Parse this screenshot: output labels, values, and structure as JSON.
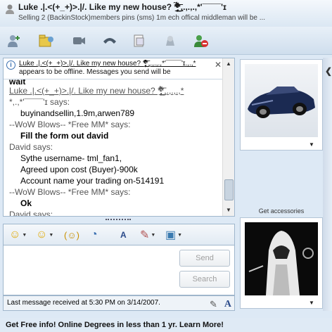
{
  "window": {
    "title": "Luke .|.<(+_+)>.|/. Like my new house? *̡̢̛̹̹̬̙̱̩̝̞͌ͦ̃̆̽͊̈́ͥ̾͗ͨͨ͟͢͜͢͞͞*,.,.,.,*'¯¯¯¯'ɪ",
    "status": "Selling 2 (BackinStock)members pins (sms) 1m ech offical middleman will be ..."
  },
  "toolbar": {
    "buttons": [
      {
        "name": "invite-icon"
      },
      {
        "name": "send-files-icon"
      },
      {
        "name": "video-icon"
      },
      {
        "name": "call-icon"
      },
      {
        "name": "activities-icon"
      },
      {
        "name": "games-icon"
      },
      {
        "name": "block-icon"
      }
    ]
  },
  "notice": {
    "line1": "Luke .|.<(+_+)>.|/. Like my new house? *̡̢̛̹̹̬̙̱̩̝̞͌ͦ̃̆̽͊̈́ͥ̾͗ͨͨ͟͢͜͢͞͞*,.,.,.,*'¯¯¯¯'ɪ.,.,*",
    "line2": "appears to be offline. Messages you send will be"
  },
  "messages": {
    "partial_top": "wait",
    "luke_sender_1": "Luke .|.<(+_+)>.|/. Like my new house? *̡̢̛̹̹̬̙̱̩̝̞͌ͦ̃̆̽͊̈́ͥ̾͗ͨͨ͟͢͜͢͞͞*,.,.,.,*",
    "luke_sender_2": "*,.,*'¯¯¯¯'ɪ says:",
    "luke_line": "buyinandsellin,1.9m,arwen789",
    "wow_sender_1": "--WoW Blows-- *Free MM* says:",
    "wow_line_1": "Fill the form out david",
    "david_sender_1": "David says:",
    "david_lines": [
      "Sythe username- tml_fan1,",
      "Agreed upon cost (Buyer)-900k",
      "Account name your trading on-514191"
    ],
    "wow_sender_2": "--WoW Blows-- *Free MM* says:",
    "wow_line_2": "Ok",
    "david_sender_2": "David says:"
  },
  "input_toolbar": {
    "emoticon": "☺",
    "wink": "☺",
    "nudge": "(☺)",
    "voice_clip": "◔",
    "font": "A",
    "background": "✎",
    "handwriting": "▣"
  },
  "buttons": {
    "send": "Send",
    "search": "Search"
  },
  "statusbar": {
    "text": "Last message received at 5:30 PM on 3/14/2007."
  },
  "right_panel": {
    "get_accessories": "Get accessories",
    "collapse_arrow": "❮"
  },
  "adbar": {
    "text": "Get Free info! Online Degrees in less than 1 yr. Learn More!"
  }
}
